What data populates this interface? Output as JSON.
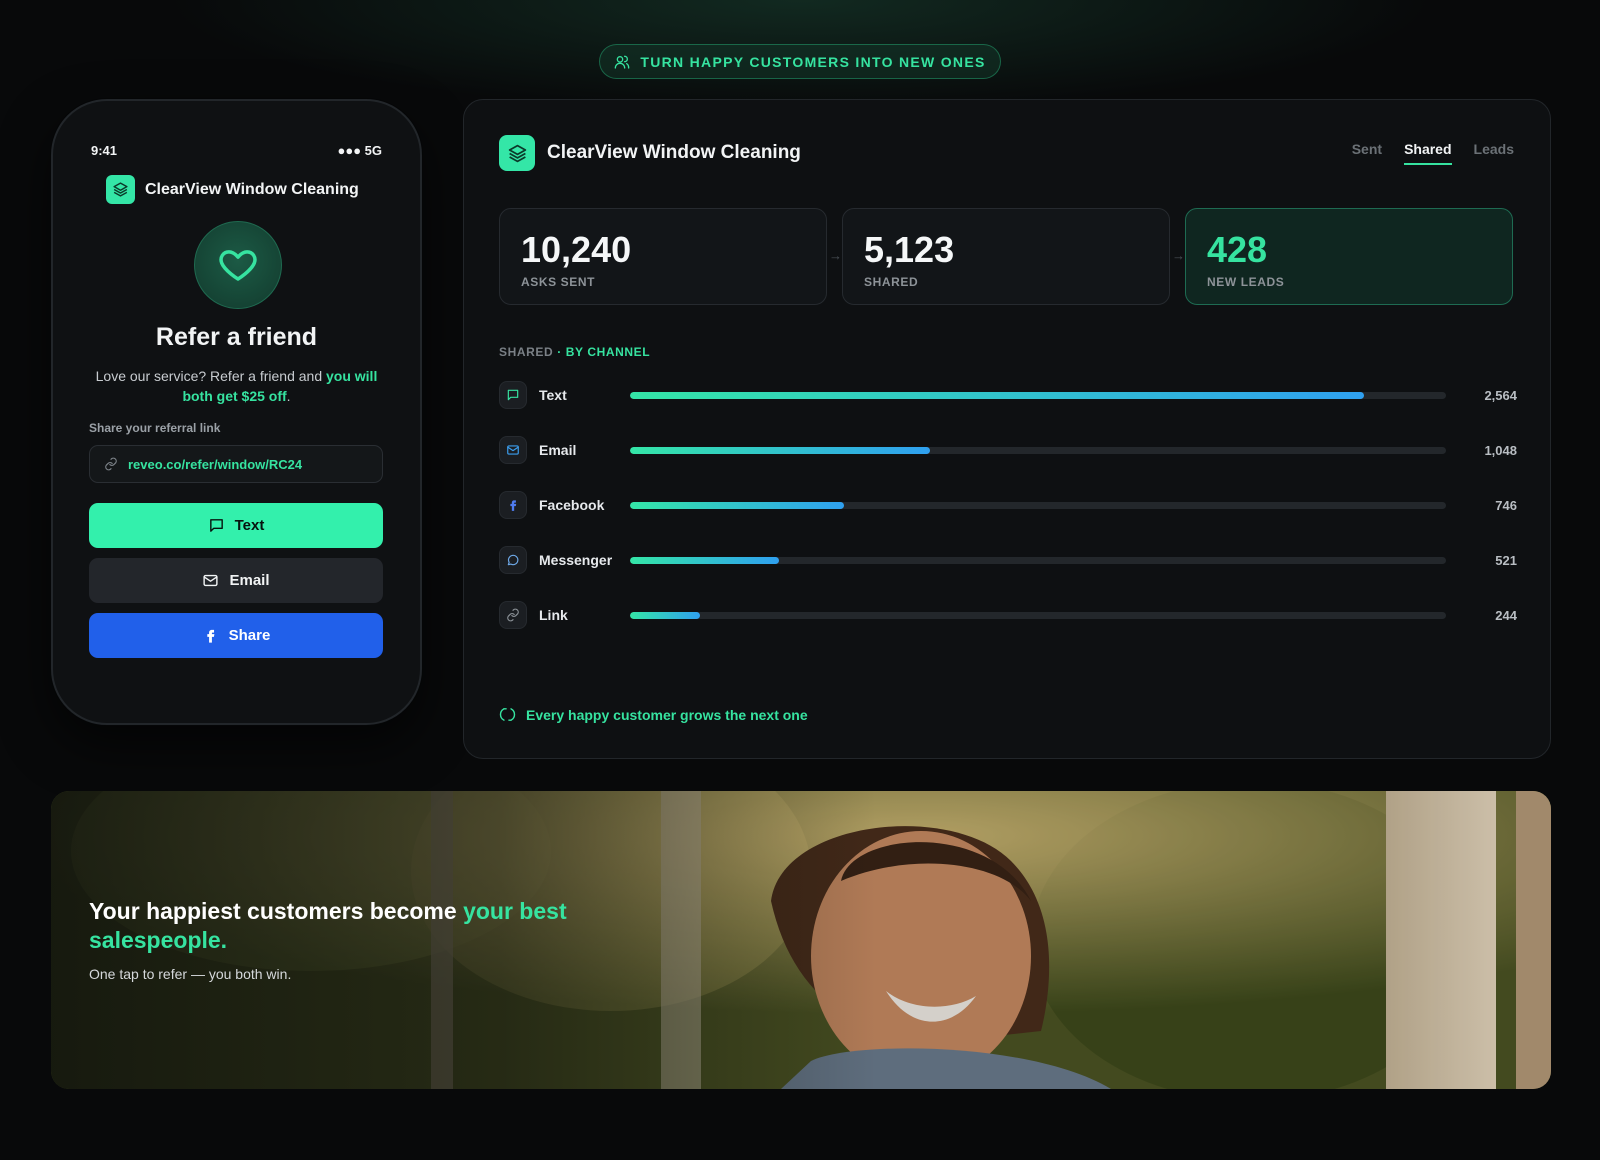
{
  "top_pill": {
    "label": "TURN HAPPY CUSTOMERS INTO NEW ONES",
    "icon": "users-icon"
  },
  "phone": {
    "time": "9:41",
    "signal": "●●● 5G",
    "brand": "ClearView Window Cleaning",
    "title": "Refer a friend",
    "desc_plain": "Love our service? Refer a friend and ",
    "desc_highlight": "you will both get $25 off",
    "desc_end": ".",
    "link_label": "Share your referral link",
    "link_value": "reveo.co/refer/window/RC24",
    "buttons": {
      "text": "Text",
      "email": "Email",
      "share": "Share"
    }
  },
  "dashboard": {
    "brand": "ClearView Window Cleaning",
    "tabs": [
      "Sent",
      "Shared",
      "Leads"
    ],
    "active_tab": "Shared",
    "stats": [
      {
        "value": "10,240",
        "label": "ASKS SENT"
      },
      {
        "value": "5,123",
        "label": "SHARED"
      },
      {
        "value": "428",
        "label": "NEW LEADS"
      }
    ],
    "section_label": "SHARED",
    "section_highlight": "· BY CHANNEL",
    "channels": [
      {
        "name": "Text",
        "value": 2564,
        "display": "2,564",
        "icon": "message-square-icon",
        "color": "#36e3a0"
      },
      {
        "name": "Email",
        "value": 1048,
        "display": "1,048",
        "icon": "mail-icon",
        "color": "#3b9ff0"
      },
      {
        "name": "Facebook",
        "value": 746,
        "display": "746",
        "icon": "facebook-icon",
        "color": "#4f7cf0"
      },
      {
        "name": "Messenger",
        "value": 521,
        "display": "521",
        "icon": "message-circle-icon",
        "color": "#6ea9e8"
      },
      {
        "name": "Link",
        "value": 244,
        "display": "244",
        "icon": "link-icon",
        "color": "#8b9197"
      }
    ],
    "footer_note": "Every happy customer grows the next one"
  },
  "banner": {
    "title_plain": "Your happiest customers become ",
    "title_highlight": "your best salespeople.",
    "subtitle": "One tap to refer — you both win."
  },
  "colors": {
    "accent": "#36e3a0",
    "facebook": "#2160ea",
    "background": "#08090a"
  }
}
